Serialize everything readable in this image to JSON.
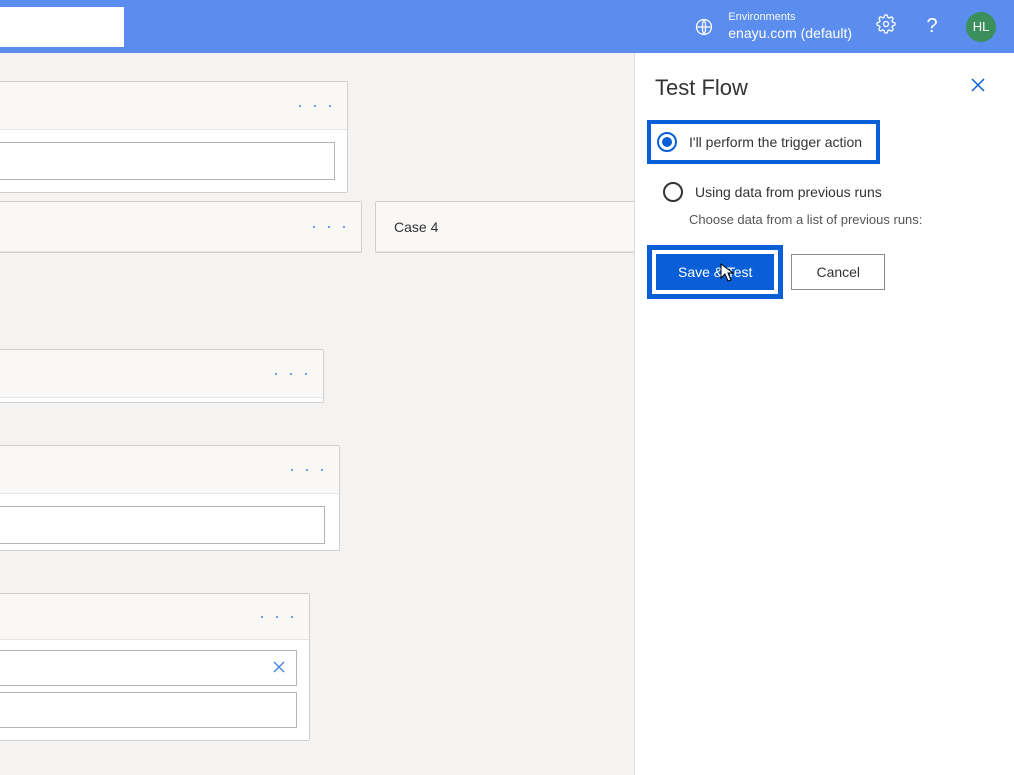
{
  "header": {
    "environments_label": "Environments",
    "environment_value": "enayu.com (default)",
    "avatar_initials": "HL"
  },
  "canvas": {
    "case4_label": "Case 4"
  },
  "panel": {
    "title": "Test Flow",
    "option1": "I'll perform the trigger action",
    "option2": "Using data from previous runs",
    "option2_sub": "Choose data from a list of previous runs:",
    "save_test": "Save & Test",
    "cancel": "Cancel"
  }
}
